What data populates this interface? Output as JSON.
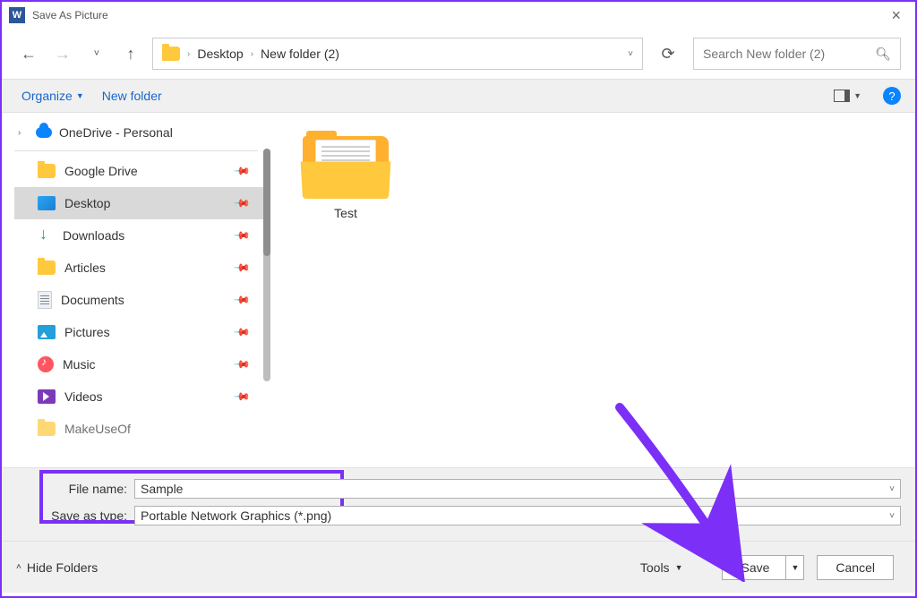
{
  "window": {
    "title": "Save As Picture"
  },
  "nav": {
    "crumbs": [
      "Desktop",
      "New folder (2)"
    ],
    "search_placeholder": "Search New folder (2)"
  },
  "toolbar": {
    "organize": "Organize",
    "newfolder": "New folder"
  },
  "sidebar": {
    "tree_root": "OneDrive - Personal",
    "items": [
      {
        "label": "Google Drive",
        "icon": "folder"
      },
      {
        "label": "Desktop",
        "icon": "desktop"
      },
      {
        "label": "Downloads",
        "icon": "download"
      },
      {
        "label": "Articles",
        "icon": "folder"
      },
      {
        "label": "Documents",
        "icon": "doc"
      },
      {
        "label": "Pictures",
        "icon": "pic"
      },
      {
        "label": "Music",
        "icon": "music"
      },
      {
        "label": "Videos",
        "icon": "video"
      },
      {
        "label": "MakeUseOf",
        "icon": "folder"
      }
    ]
  },
  "content": {
    "items": [
      {
        "name": "Test",
        "type": "folder"
      }
    ]
  },
  "form": {
    "filename_label": "File name:",
    "filename_value": "Sample",
    "saveastype_label": "Save as type:",
    "saveastype_value": "Portable Network Graphics (*.png)"
  },
  "footer": {
    "hidefolders": "Hide Folders",
    "tools": "Tools",
    "save": "Save",
    "cancel": "Cancel"
  },
  "annotation": {
    "highlight_color": "#7b2ff7"
  }
}
